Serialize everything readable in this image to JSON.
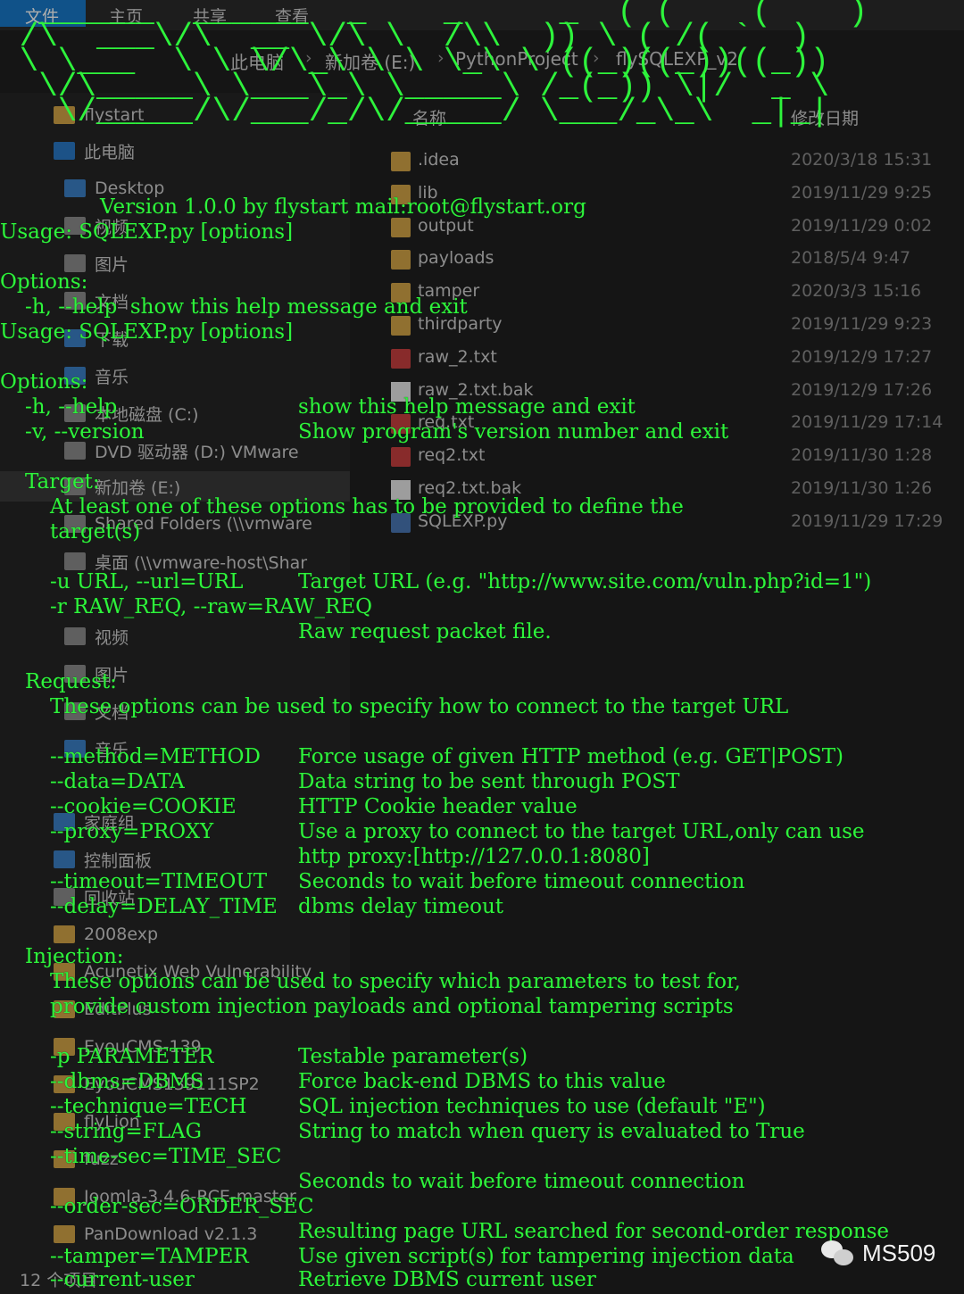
{
  "explorer": {
    "ribbon_tabs": [
      "文件",
      "主页",
      "共享",
      "查看"
    ],
    "breadcrumb": [
      "此电脑",
      "新加卷 (E:)",
      "PythonProject",
      "flySQLEXP_v2"
    ],
    "nav": [
      "flystart",
      "此电脑",
      "Desktop",
      "视频",
      "图片",
      "文档",
      "下载",
      "音乐",
      "本地磁盘 (C:)",
      "DVD 驱动器 (D:) VMware",
      "新加卷 (E:)",
      "Shared Folders (\\\\vmware",
      "桌面 (\\\\vmware-host\\Shar",
      "视频",
      "图片",
      "文档",
      "音乐",
      "家庭组",
      "控制面板",
      "回收站",
      "2008exp",
      "Acunetix Web Vulnerability",
      "EditPlus",
      "EyouCMS-139",
      "EyouCMS139111SP2",
      "flyLion",
      "fuzz",
      "Joomla-3.4.6-RCE-master",
      "PanDownload v2.1.3"
    ],
    "columns": {
      "name": "名称",
      "date": "修改日期"
    },
    "files": [
      {
        "name": ".idea",
        "date": "2020/3/18 15:31",
        "type": "folder"
      },
      {
        "name": "lib",
        "date": "2019/11/29 9:25",
        "type": "folder"
      },
      {
        "name": "output",
        "date": "2019/11/29 0:02",
        "type": "folder"
      },
      {
        "name": "payloads",
        "date": "2018/5/4 9:47",
        "type": "folder"
      },
      {
        "name": "tamper",
        "date": "2020/3/3 15:16",
        "type": "folder"
      },
      {
        "name": "thirdparty",
        "date": "2019/11/29 9:23",
        "type": "folder"
      },
      {
        "name": "raw_2.txt",
        "date": "2019/12/9 17:27",
        "type": "txt"
      },
      {
        "name": "raw_2.txt.bak",
        "date": "2019/12/9 17:26",
        "type": "file"
      },
      {
        "name": "req.txt",
        "date": "2019/11/29 17:14",
        "type": "txt"
      },
      {
        "name": "req2.txt",
        "date": "2019/11/30 1:28",
        "type": "txt"
      },
      {
        "name": "req2.txt.bak",
        "date": "2019/11/30 1:26",
        "type": "file"
      },
      {
        "name": "SQLEXP.py",
        "date": "2019/11/29 17:29",
        "type": "py"
      }
    ],
    "status": "12 个项目"
  },
  "terminal": {
    "banner_art": "  ______  ______  _    _     _  ( (    (    )\n /\\  ___\\/\\  __ \\/\\ \\  /\\\\  )) \\ ( /( `  )\n \\ \\___  \\ \\ \\/\\_\\ \\ \\ \\_\\ \\ ((_)((_))((_))\n  \\/\\_____\\ \\___\\_\\ \\_____\\ /_(_)) \\|/  _ \\\n   \\/_____/\\/___/_/\\/_____/ \\___/_\\_\\  _|_|",
    "lines": [
      "Version 1.0.0 by flystart mail:root@flystart.org",
      "Usage: SQLEXP.py [options]",
      "Options:",
      "-h, --help  show this help message and exit",
      "Usage: SQLEXP.py [options]",
      "Options:",
      "-h, --help",
      "show this help message and exit",
      "-v, --version",
      "Show program's version number and exit",
      "Target:",
      "At least one of these options has to be provided to define the",
      "target(s)",
      "-u URL, --url=URL",
      "Target URL (e.g. \"http://www.site.com/vuln.php?id=1\")",
      "-r RAW_REQ, --raw=RAW_REQ",
      "Raw request packet file.",
      "Request:",
      "These options can be used to specify how to connect to the target URL",
      "--method=METHOD",
      "Force usage of given HTTP method (e.g. GET|POST)",
      "--data=DATA",
      "Data string to be sent through POST",
      "--cookie=COOKIE",
      "HTTP Cookie header value",
      "--proxy=PROXY",
      "Use a proxy to connect to the target URL,only can use",
      "http proxy:[http://127.0.0.1:8080]",
      "--timeout=TIMEOUT",
      "Seconds to wait before timeout connection",
      "--delay=DELAY_TIME",
      "dbms delay timeout",
      "Injection:",
      "These options can be used to specify which parameters to test for,",
      "provide custom injection payloads and optional tampering scripts",
      "-p PARAMETER",
      "Testable parameter(s)",
      "--dbms=DBMS",
      "Force back-end DBMS to this value",
      "--technique=TECH",
      "SQL injection techniques to use (default \"E\")",
      "--string=FLAG",
      "String to match when query is evaluated to True",
      "--time-sec=TIME_SEC",
      "Seconds to wait before timeout connection",
      "--order-sec=ORDER_SEC",
      "Resulting page URL searched for second-order response",
      "--tamper=TAMPER",
      "Use given script(s) for tampering injection data",
      "--current-user",
      "Retrieve DBMS current user"
    ]
  },
  "watermark": {
    "text": "MS509",
    "icon": "wechat-icon"
  }
}
